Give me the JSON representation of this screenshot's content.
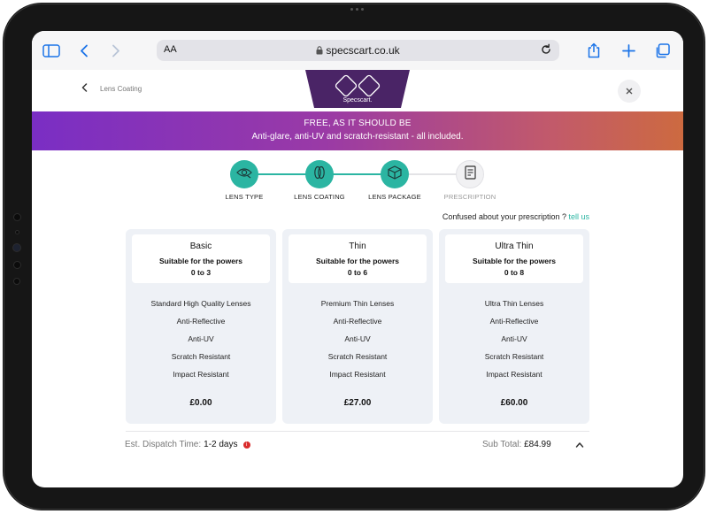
{
  "browser": {
    "text_size_label": "AA",
    "url": "specscart.co.uk"
  },
  "header": {
    "breadcrumb": "Lens Coating",
    "logo_text": "Specscart."
  },
  "promo": {
    "line1": "FREE, AS IT SHOULD BE",
    "line2": "Anti-glare, anti-UV and scratch-resistant - all included."
  },
  "steps": [
    {
      "label": "LENS TYPE",
      "state": "complete",
      "icon": "eye-icon"
    },
    {
      "label": "LENS COATING",
      "state": "complete",
      "icon": "lens-icon"
    },
    {
      "label": "LENS PACKAGE",
      "state": "complete",
      "icon": "box-icon"
    },
    {
      "label": "PRESCRIPTION",
      "state": "pending",
      "icon": "document-icon"
    }
  ],
  "help": {
    "text": "Confused about your prescription ?",
    "link": "tell us"
  },
  "packages": [
    {
      "name": "Basic",
      "suitable": "Suitable for the powers",
      "range": "0 to 3",
      "features": [
        "Standard High Quality Lenses",
        "Anti-Reflective",
        "Anti-UV",
        "Scratch Resistant",
        "Impact Resistant"
      ],
      "price": "£0.00"
    },
    {
      "name": "Thin",
      "suitable": "Suitable for the powers",
      "range": "0 to 6",
      "features": [
        "Premium Thin Lenses",
        "Anti-Reflective",
        "Anti-UV",
        "Scratch Resistant",
        "Impact Resistant"
      ],
      "price": "£27.00"
    },
    {
      "name": "Ultra Thin",
      "suitable": "Suitable for the powers",
      "range": "0 to 8",
      "features": [
        "Ultra Thin Lenses",
        "Anti-Reflective",
        "Anti-UV",
        "Scratch Resistant",
        "Impact Resistant"
      ],
      "price": "£60.00"
    }
  ],
  "footer": {
    "dispatch_label": "Est. Dispatch Time:",
    "dispatch_value": "1-2 days",
    "subtotal_label": "Sub Total:",
    "subtotal_value": "£84.99"
  },
  "colors": {
    "accent": "#2bb5a2",
    "promo_start": "#7a2ec4",
    "promo_end": "#cd6a40",
    "logo_bg": "#4a2466",
    "safari_blue": "#1a73e8"
  }
}
